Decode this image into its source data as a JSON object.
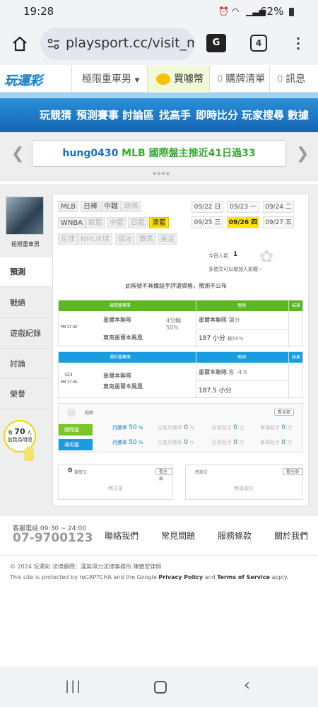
{
  "status": {
    "time": "19:28",
    "battery": "62%"
  },
  "browser": {
    "url": "playsport.cc/visit_me",
    "tab_count": "4"
  },
  "site": {
    "logo": "玩運彩",
    "menu_user": "極限重車男",
    "coins": "買噱幣",
    "cart_count": "0",
    "cart": "購牌清單",
    "msg_count": "0",
    "msg": "訊息"
  },
  "nav": [
    "玩競猜",
    "預測賽事",
    "討論區",
    "找高手",
    "即時比分",
    "玩家搜尋",
    "數據"
  ],
  "notice": {
    "user": "hung0430",
    "text": " MLB 國際盤主推近41日過33"
  },
  "sidebar": {
    "username": "極限重車男",
    "items": [
      "預測",
      "戰績",
      "遊戲紀錄",
      "討論",
      "榮譽"
    ],
    "badge_prefix": "有",
    "badge_count": "70",
    "badge_unit": "人",
    "badge_line2": "加我為明燈"
  },
  "leagues_row1": [
    "MLB",
    "日棒",
    "中職",
    "韓棒"
  ],
  "leagues_row2": [
    "WNBA",
    "歐籃",
    "中籃",
    "日籃",
    "澳籃"
  ],
  "leagues_row3": [
    "足球",
    "NHL冰球",
    "俄冰",
    "賽馬",
    "美足"
  ],
  "dates": [
    "09/22 日",
    "09/23 一",
    "09/24 二",
    "09/25 三",
    "09/26 四",
    "09/27 五"
  ],
  "popularity": {
    "label": "今日人氣",
    "value": "1",
    "sub": "多發文可以增加人氣喔~"
  },
  "notice_text": "此帳號不具備殺手評選資格，預測不公布",
  "intl": {
    "head": "國際盤賽事",
    "pred": "預測",
    "result": "結果",
    "time": "PM 17:30",
    "team1": "墨爾本聯隊",
    "team2": "東南墨爾本鳳凰",
    "spread": "4分輸50%",
    "pick1": "墨爾本聯隊",
    "pick1_note": "讓分",
    "pick2": "187 小分",
    "pick2_note": "輸50%"
  },
  "local": {
    "head": "運彩盤賽事",
    "pred": "預測",
    "result": "結果",
    "game_no": "323",
    "time": "PM 17:30",
    "team1": "墨爾本聯隊",
    "team2": "東南墨爾本鳳凰",
    "pick1": "墨爾本聯隊",
    "pick1_note": "客 -4.5",
    "pick2": "187.5 小分"
  },
  "record": {
    "title": "戰績",
    "view_all": "看全部",
    "rows": [
      {
        "name": "國際盤",
        "color": "#7cc427",
        "month": "月勝率",
        "month_val": "50",
        "main": "主推月勝率",
        "main_val": "0",
        "killer": "莊家殺手",
        "killer_val": "0",
        "single": "單場殺手",
        "single_val": "0"
      },
      {
        "name": "運彩盤",
        "color": "#1a9de0",
        "month": "月勝率",
        "month_val": "50",
        "main": "主推月勝率",
        "main_val": "0",
        "killer": "莊家殺手",
        "killer_val": "0",
        "single": "單場殺手",
        "single_val": "0"
      }
    ],
    "pct": "%",
    "ci": "次"
  },
  "posts": {
    "count": "0",
    "label": "篇發文",
    "view_all": "看全部",
    "empty": "無文章"
  },
  "replies": {
    "label": "感謝文",
    "view_all": "看全部",
    "empty": "無感謝文"
  },
  "footer": {
    "hotline_label": "客服電話 09:30 ~ 24:00",
    "phone": "07-9700123",
    "links": [
      "聯絡我們",
      "常見問題",
      "服務條款",
      "關於我們"
    ],
    "copyright": "© 2024 玩運彩 法律顧問：漢英得力法律事務所 陳鎮宏律師",
    "recaptcha_pre": "This site is protected by reCAPTCHA and the Google ",
    "privacy": "Privacy Policy",
    "and": " and ",
    "terms": "Terms of Service",
    "apply": " apply."
  }
}
